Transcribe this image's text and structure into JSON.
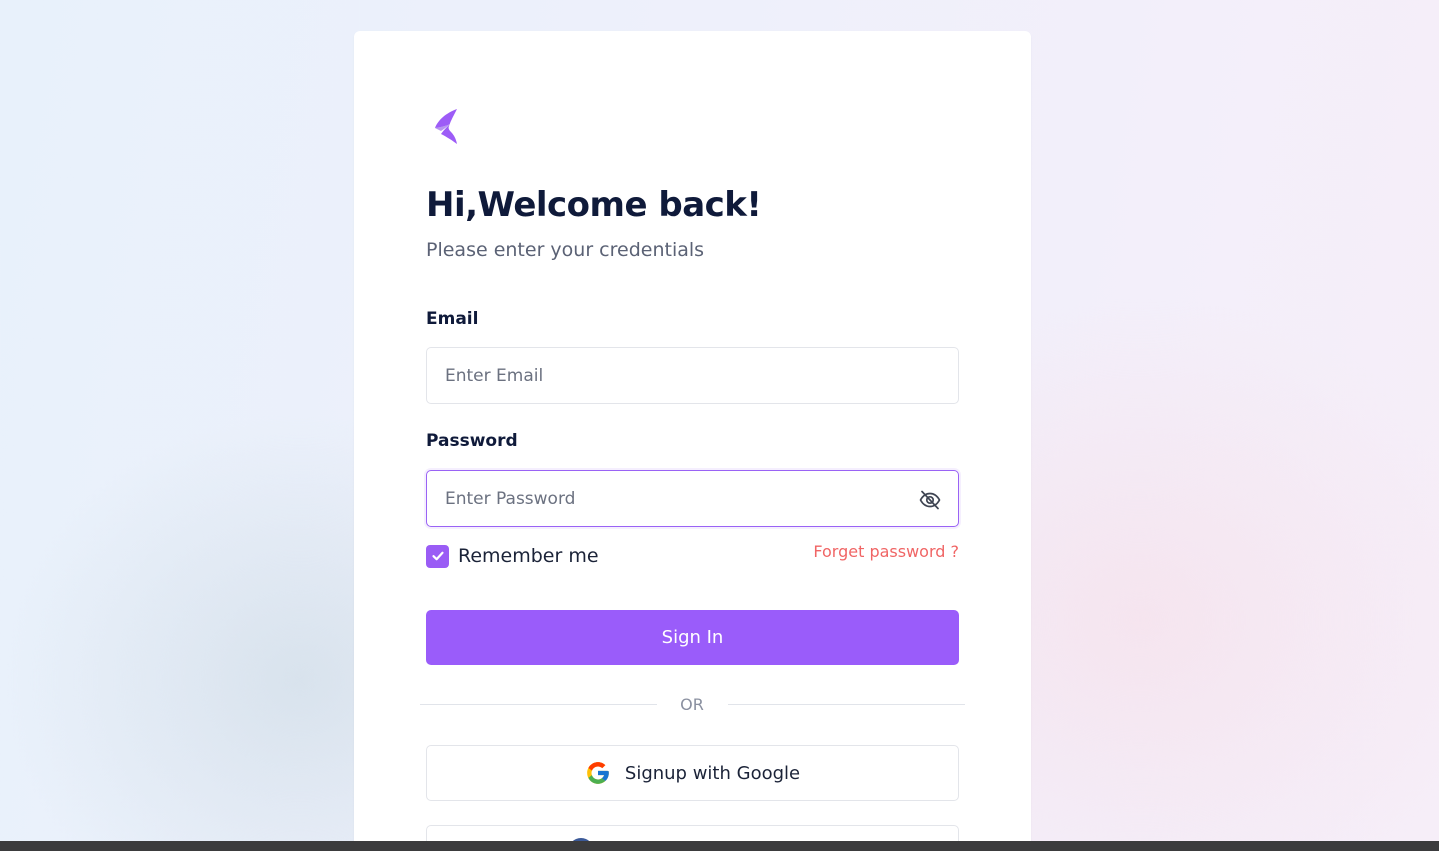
{
  "colors": {
    "accent": "#9a5cfa",
    "title": "#0f1a3a",
    "link": "#f06565",
    "focus_border": "#9a63f5"
  },
  "login": {
    "title": "Hi,Welcome back!",
    "subtitle": "Please enter your credentials",
    "email": {
      "label": "Email",
      "placeholder": "Enter Email",
      "value": ""
    },
    "password": {
      "label": "Password",
      "placeholder": "Enter Password",
      "value": "",
      "toggle_icon": "eye-off-icon"
    },
    "remember": {
      "label": "Remember me",
      "checked": true
    },
    "forgot_label": "Forget password ?",
    "signin_label": "Sign In",
    "divider_label": "OR",
    "google_label": "Signup with Google",
    "icons": {
      "logo": "brand-logo-icon",
      "google": "google-icon",
      "check": "check-icon"
    }
  }
}
